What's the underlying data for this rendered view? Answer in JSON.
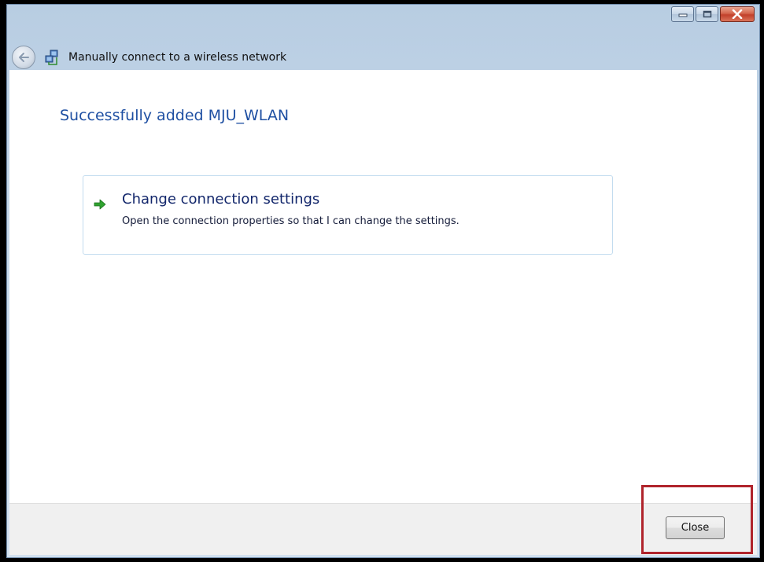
{
  "window": {
    "title": "Manually connect to a wireless network",
    "controls": [
      "minimize",
      "maximize",
      "close"
    ]
  },
  "main": {
    "heading": "Successfully added MJU_WLAN",
    "option": {
      "icon": "green-arrow-icon",
      "title": "Change connection settings",
      "description": "Open the connection properties so that I can change the settings."
    }
  },
  "footer": {
    "close_label": "Close"
  },
  "colors": {
    "heading": "#1e4fa2",
    "link_title": "#12266b",
    "highlight": "#b0242c",
    "window_close": "#c2402a"
  }
}
